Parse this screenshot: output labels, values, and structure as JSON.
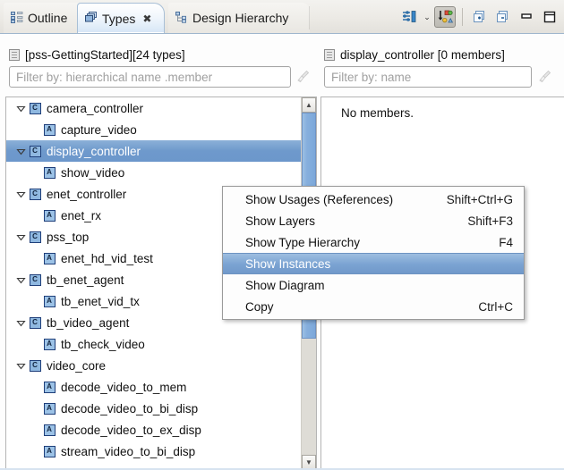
{
  "tabs": [
    {
      "label": "Outline",
      "icon": "outline-icon",
      "active": false,
      "closable": false
    },
    {
      "label": "Types",
      "icon": "types-icon",
      "active": true,
      "closable": true,
      "close_glyph": "✖"
    },
    {
      "label": "Design Hierarchy",
      "icon": "hierarchy-icon",
      "active": false,
      "closable": false
    }
  ],
  "toolbar": {
    "filter_button": "filter-options-icon",
    "dropdown_arrow": "⌄",
    "sort_button": "sort-types-icon",
    "expand_all": "expand-all-icon",
    "collapse_all": "collapse-all-icon",
    "minimize": "minimize-icon",
    "maximize": "maximize-icon"
  },
  "left_pane": {
    "header_label": "[pss-GettingStarted][24 types]",
    "header_icon": "document-icon",
    "filter_placeholder": "Filter by: hierarchical name .member",
    "filter_value": "",
    "clear_icon": "clear-filter-broom-icon",
    "tree": [
      {
        "label": "camera_controller",
        "kind": "class",
        "level": 0,
        "expanded": true,
        "selected": false
      },
      {
        "label": "capture_video",
        "kind": "action",
        "level": 1,
        "expanded": null,
        "selected": false
      },
      {
        "label": "display_controller",
        "kind": "class",
        "level": 0,
        "expanded": true,
        "selected": true
      },
      {
        "label": "show_video",
        "kind": "action",
        "level": 1,
        "expanded": null,
        "selected": false
      },
      {
        "label": "enet_controller",
        "kind": "class",
        "level": 0,
        "expanded": true,
        "selected": false
      },
      {
        "label": "enet_rx",
        "kind": "action",
        "level": 1,
        "expanded": null,
        "selected": false
      },
      {
        "label": "pss_top",
        "kind": "class",
        "level": 0,
        "expanded": true,
        "selected": false
      },
      {
        "label": "enet_hd_vid_test",
        "kind": "action",
        "level": 1,
        "expanded": null,
        "selected": false
      },
      {
        "label": "tb_enet_agent",
        "kind": "class",
        "level": 0,
        "expanded": true,
        "selected": false
      },
      {
        "label": "tb_enet_vid_tx",
        "kind": "action",
        "level": 1,
        "expanded": null,
        "selected": false
      },
      {
        "label": "tb_video_agent",
        "kind": "class",
        "level": 0,
        "expanded": true,
        "selected": false
      },
      {
        "label": "tb_check_video",
        "kind": "action",
        "level": 1,
        "expanded": null,
        "selected": false
      },
      {
        "label": "video_core",
        "kind": "class",
        "level": 0,
        "expanded": true,
        "selected": false
      },
      {
        "label": "decode_video_to_mem",
        "kind": "action",
        "level": 1,
        "expanded": null,
        "selected": false
      },
      {
        "label": "decode_video_to_bi_disp",
        "kind": "action",
        "level": 1,
        "expanded": null,
        "selected": false
      },
      {
        "label": "decode_video_to_ex_disp",
        "kind": "action",
        "level": 1,
        "expanded": null,
        "selected": false
      },
      {
        "label": "stream_video_to_bi_disp",
        "kind": "action",
        "level": 1,
        "expanded": null,
        "selected": false
      }
    ],
    "scrollbar": {
      "up_arrow": "▲",
      "down_arrow": "▼",
      "thumb_top_pct": 0,
      "thumb_height_pct": 66
    }
  },
  "right_pane": {
    "header_label": "display_controller [0 members]",
    "header_icon": "document-icon",
    "filter_placeholder": "Filter by: name",
    "filter_value": "",
    "clear_icon": "clear-filter-broom-icon",
    "empty_message": "No members."
  },
  "context_menu": {
    "items": [
      {
        "label": "Show Usages (References)",
        "accel": "Shift+Ctrl+G",
        "highlighted": false
      },
      {
        "label": "Show Layers",
        "accel": "Shift+F3",
        "highlighted": false
      },
      {
        "label": "Show Type Hierarchy",
        "accel": "F4",
        "highlighted": false
      },
      {
        "label": "Show Instances",
        "accel": "",
        "highlighted": true
      },
      {
        "label": "Show Diagram",
        "accel": "",
        "highlighted": false
      },
      {
        "label": "Copy",
        "accel": "Ctrl+C",
        "highlighted": false
      }
    ]
  },
  "colors": {
    "selection_blue": "#6e99cc",
    "menu_highlight": "#7aa3d2",
    "tab_active": "#d6e6f6",
    "icon_border": "#1f3f7a",
    "icon_fill": "#8fb8e0",
    "placeholder": "#a0a0a0"
  }
}
